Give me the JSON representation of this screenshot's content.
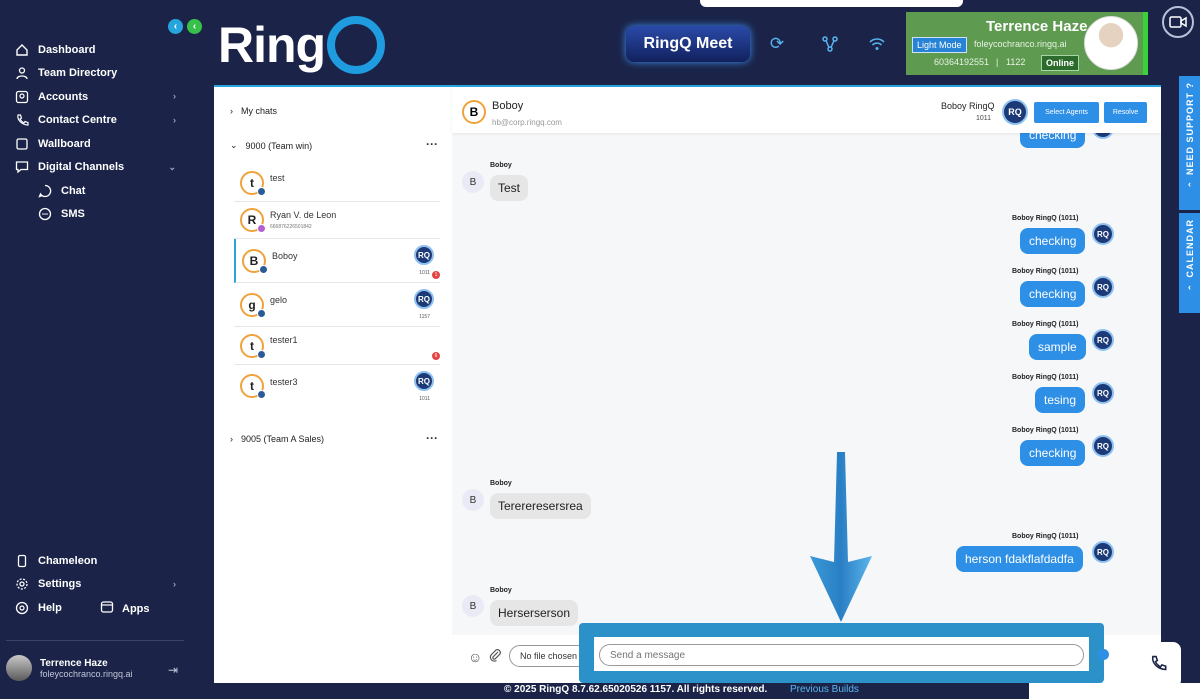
{
  "sidebar": {
    "items": [
      {
        "label": "Dashboard",
        "icon": "home-icon"
      },
      {
        "label": "Team Directory",
        "icon": "user-icon"
      },
      {
        "label": "Accounts",
        "icon": "accounts-icon"
      },
      {
        "label": "Contact Centre",
        "icon": "phone-icon"
      },
      {
        "label": "Wallboard",
        "icon": "wallboard-icon"
      },
      {
        "label": "Digital Channels",
        "icon": "chat-bubble-icon"
      }
    ],
    "sub_items": [
      {
        "label": "Chat",
        "icon": "chat-icon"
      },
      {
        "label": "SMS",
        "icon": "sms-icon"
      }
    ],
    "bottom_items": [
      {
        "label": "Chameleon"
      },
      {
        "label": "Settings"
      },
      {
        "label": "Help"
      },
      {
        "label": "Apps"
      }
    ],
    "user": {
      "name": "Terrence Haze",
      "email": "foleycochranco.ringq.ai"
    }
  },
  "brand": {
    "logo_text": "Ring",
    "meet_label": "RingQ Meet",
    "accent": "#2e8fe6",
    "online_color": "#39d339"
  },
  "profile": {
    "name": "Terrence Haze",
    "email": "foleycochranco.ringq.ai",
    "number": "60364192551",
    "separator": "|",
    "ext": "1122",
    "mode_label": "Light Mode",
    "status": "Online"
  },
  "chat_list": {
    "my_chats": "My chats",
    "group1": "9000 (Team win)",
    "group2": "9005 (Team A Sales)",
    "items": [
      {
        "initial": "t",
        "name": "test",
        "phone": "",
        "ext": "",
        "badge": ""
      },
      {
        "initial": "R",
        "name": "Ryan V. de Leon",
        "phone": "666876226501842",
        "ext": "",
        "badge": ""
      },
      {
        "initial": "B",
        "name": "Boboy",
        "phone": "",
        "ext": "1011",
        "badge": "1"
      },
      {
        "initial": "g",
        "name": "gelo",
        "phone": "",
        "ext": "1157",
        "badge": ""
      },
      {
        "initial": "t",
        "name": "tester1",
        "phone": "",
        "ext": "",
        "badge": "6"
      },
      {
        "initial": "t",
        "name": "tester3",
        "phone": "",
        "ext": "1011",
        "badge": ""
      }
    ]
  },
  "chat": {
    "contact_initial": "B",
    "contact_name": "Boboy",
    "contact_email": "hb@corp.ringq.com",
    "agent_name": "Boboy RingQ",
    "agent_ext": "1011",
    "select_agents": "Select Agents",
    "resolve": "Resolve",
    "messages": [
      {
        "dir": "out",
        "sender": "",
        "text": "checking"
      },
      {
        "dir": "in",
        "sender": "Boboy",
        "text": "Test"
      },
      {
        "dir": "out",
        "sender": "Boboy RingQ (1011)",
        "text": "checking"
      },
      {
        "dir": "out",
        "sender": "Boboy RingQ (1011)",
        "text": "checking"
      },
      {
        "dir": "out",
        "sender": "Boboy RingQ (1011)",
        "text": "sample"
      },
      {
        "dir": "out",
        "sender": "Boboy RingQ (1011)",
        "text": "tesing"
      },
      {
        "dir": "out",
        "sender": "Boboy RingQ (1011)",
        "text": "checking"
      },
      {
        "dir": "in",
        "sender": "Boboy",
        "text": "Terereresersrea"
      },
      {
        "dir": "out",
        "sender": "Boboy RingQ (1011)",
        "text": "herson fdakflafdadfa"
      },
      {
        "dir": "in",
        "sender": "Boboy",
        "text": "Herserserson"
      }
    ],
    "file_label": "No file chosen",
    "input_placeholder": "Send a message"
  },
  "right_tabs": {
    "support": "NEED SUPPORT ?",
    "calendar": "CALENDAR"
  },
  "footer": {
    "copyright": "© 2025 RingQ 8.7.62.65020526 1157. All rights reserved.",
    "previous_builds": "Previous Builds"
  }
}
